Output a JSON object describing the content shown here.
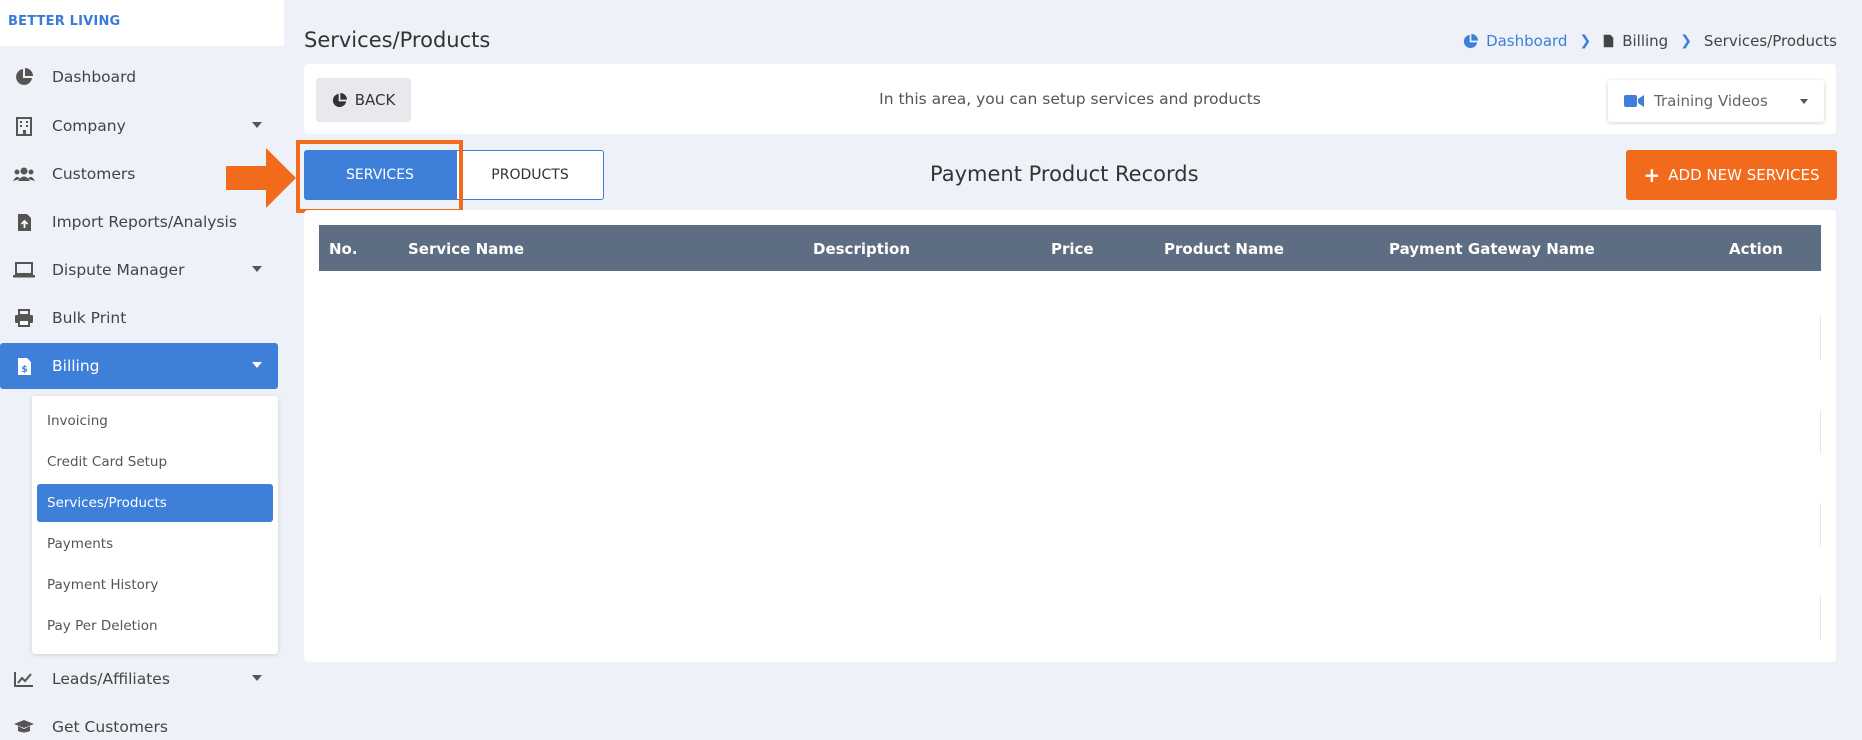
{
  "brand": "BETTER LIVING",
  "sidebar": {
    "items": [
      {
        "label": "Dashboard"
      },
      {
        "label": "Company"
      },
      {
        "label": "Customers"
      },
      {
        "label": "Import Reports/Analysis"
      },
      {
        "label": "Dispute Manager"
      },
      {
        "label": "Bulk Print"
      },
      {
        "label": "Billing"
      },
      {
        "label": "Leads/Affiliates"
      },
      {
        "label": "Get Customers"
      }
    ],
    "billing_submenu": [
      {
        "label": "Invoicing"
      },
      {
        "label": "Credit Card Setup"
      },
      {
        "label": "Services/Products"
      },
      {
        "label": "Payments"
      },
      {
        "label": "Payment History"
      },
      {
        "label": "Pay Per Deletion"
      }
    ]
  },
  "header": {
    "title": "Services/Products",
    "breadcrumb": [
      "Dashboard",
      "Billing",
      "Services/Products"
    ]
  },
  "topbar": {
    "back_label": "BACK",
    "info": "In this area, you can setup services and products",
    "training_label": "Training Videos"
  },
  "tabs": {
    "services": "SERVICES",
    "products": "PRODUCTS"
  },
  "section_title": "Payment Product Records",
  "add_button": "ADD NEW SERVICES",
  "table": {
    "columns": [
      "No.",
      "Service Name",
      "Description",
      "Price",
      "Product Name",
      "Payment Gateway Name",
      "Action"
    ],
    "rows": []
  },
  "colors": {
    "primary": "#3e7fd9",
    "accent": "#f26a1b",
    "table_header": "#5d6d82"
  }
}
